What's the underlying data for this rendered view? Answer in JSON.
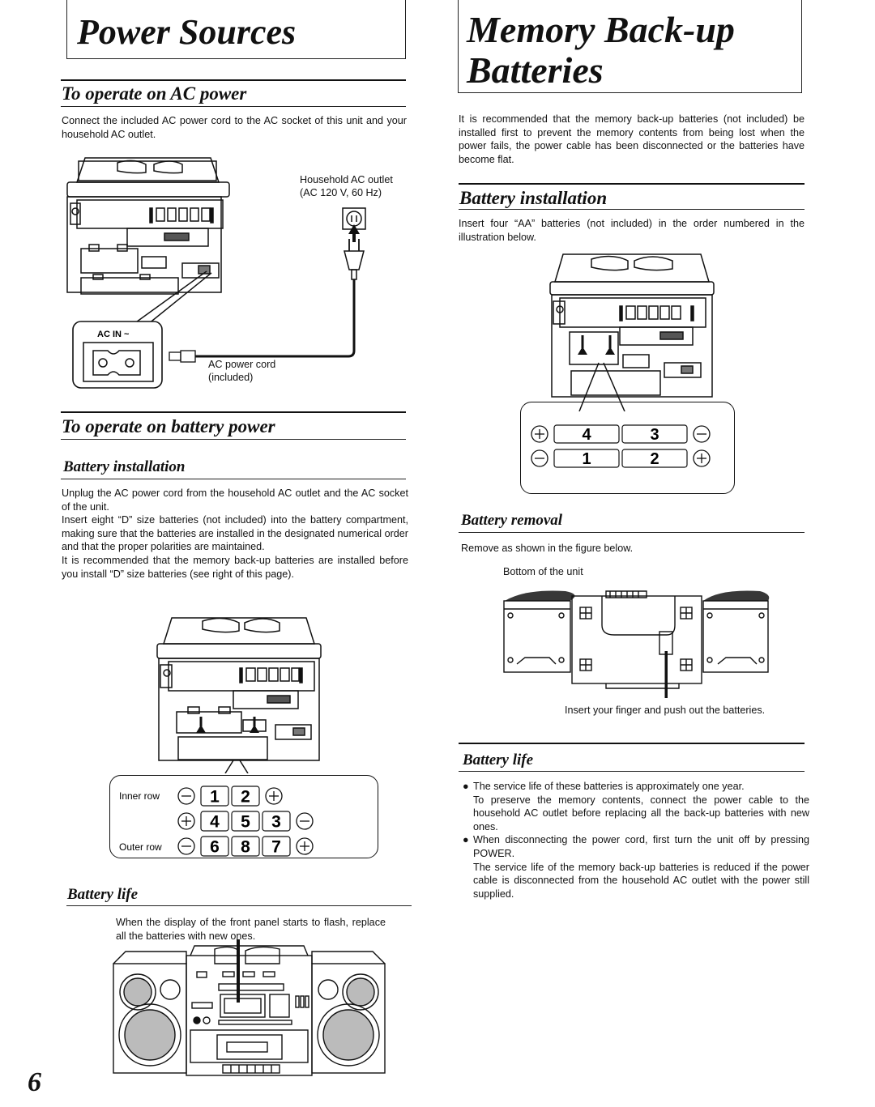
{
  "left": {
    "title": "Power Sources",
    "ac_section": {
      "heading": "To operate on AC power",
      "body": "Connect the included AC power cord to the AC socket of this unit and your household AC outlet.",
      "figure": {
        "outlet_label_line1": "Household AC outlet",
        "outlet_label_line2": "(AC 120 V, 60 Hz)",
        "socket_label": "AC IN ~",
        "cord_label_line1": "AC power cord",
        "cord_label_line2": "(included)"
      }
    },
    "battery_section": {
      "heading": "To operate on battery power",
      "installation": {
        "heading": "Battery installation",
        "paragraphs": [
          "Unplug the AC power cord from the household AC outlet and the AC socket of the unit.",
          "Insert eight “D” size batteries (not included) into the battery compartment, making sure that the batteries are installed in the designated numerical order and that the proper polarities are maintained.",
          "It is recommended that the memory back-up batteries are installed before you install “D” size batteries (see right of this page)."
        ],
        "figure": {
          "inner_row_label": "Inner row",
          "outer_row_label": "Outer row",
          "rows": [
            {
              "left_polarity": "−",
              "cells": [
                "1",
                "2"
              ],
              "right_polarity": "+"
            },
            {
              "left_polarity": "+",
              "cells": [
                "4",
                "5",
                "3"
              ],
              "right_polarity": "−"
            },
            {
              "left_polarity": "−",
              "cells": [
                "6",
                "8",
                "7"
              ],
              "right_polarity": "+"
            }
          ]
        }
      },
      "life": {
        "heading": "Battery life",
        "body": "When the display of the front panel starts to flash, replace all the batteries with new ones."
      }
    },
    "page_number": "6"
  },
  "right": {
    "title_line1": "Memory Back-up",
    "title_line2": "Batteries",
    "intro": "It is recommended that the memory back-up batteries (not included) be installed first to prevent the memory contents from being lost when the power fails, the power cable has been disconnected or the batteries have become flat.",
    "installation": {
      "heading": "Battery installation",
      "body": "Insert four “AA” batteries (not included) in the order numbered in the illustration below.",
      "figure": {
        "rows": [
          {
            "left_polarity": "+",
            "cells": [
              "4",
              "3"
            ],
            "right_polarity": "−"
          },
          {
            "left_polarity": "−",
            "cells": [
              "1",
              "2"
            ],
            "right_polarity": "+"
          }
        ]
      }
    },
    "removal": {
      "heading": "Battery removal",
      "body": "Remove as shown in the figure below.",
      "figure_label": "Bottom of the unit",
      "caption": "Insert your finger and push out the batteries."
    },
    "life": {
      "heading": "Battery life",
      "bullets": [
        {
          "lines": [
            "The service life of these batteries is approximately one year.",
            "To preserve the memory contents, connect the power cable to the household AC outlet before replacing all the back-up batteries with new ones."
          ]
        },
        {
          "lines": [
            "When disconnecting the power cord, first turn the unit off by pressing POWER.",
            "The service life of the memory back-up batteries is reduced if the power cable is disconnected from the household AC outlet with the power still supplied."
          ]
        }
      ]
    }
  }
}
